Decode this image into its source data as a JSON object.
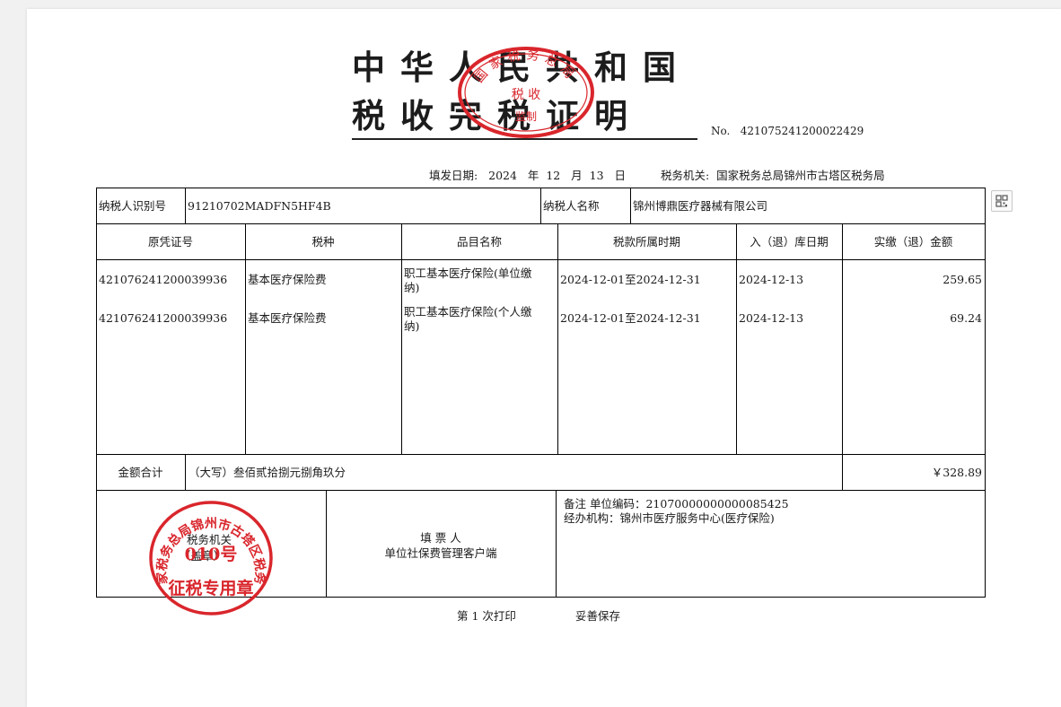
{
  "title": {
    "line1": "中华人民共和国",
    "line2": "税收完税证明"
  },
  "doc_no": {
    "label": "No.",
    "value": "421075241200022429"
  },
  "fill_date": {
    "label": "填发日期:",
    "year": "2024",
    "year_unit": "年",
    "month": "12",
    "month_unit": "月",
    "day": "13",
    "day_unit": "日"
  },
  "tax_authority": {
    "label": "税务机关:",
    "value": "国家税务总局锦州市古塔区税务局"
  },
  "taxpayer": {
    "id_label": "纳税人识别号",
    "id_value": "91210702MADFN5HF4B",
    "name_label": "纳税人名称",
    "name_value": "锦州博鼎医疗器械有限公司"
  },
  "table": {
    "headers": [
      "原凭证号",
      "税种",
      "品目名称",
      "税款所属时期",
      "入（退）库日期",
      "实缴（退）金额"
    ],
    "rows": [
      {
        "voucher": "421076241200039936",
        "tax_type": "基本医疗保险费",
        "item_line1": "职工基本医疗保险(单位缴",
        "item_line2": "纳)",
        "period": "2024-12-01至2024-12-31",
        "date": "2024-12-13",
        "amount": "259.65"
      },
      {
        "voucher": "421076241200039936",
        "tax_type": "基本医疗保险费",
        "item_line1": "职工基本医疗保险(个人缴",
        "item_line2": "纳)",
        "period": "2024-12-01至2024-12-31",
        "date": "2024-12-13",
        "amount": "69.24"
      }
    ]
  },
  "total": {
    "label": "金额合计",
    "words": "（大写）叁佰贰拾捌元捌角玖分",
    "amount": "￥328.89"
  },
  "footer_boxes": {
    "authority_label": "税务机关",
    "authority_suffix": "（盖章）",
    "filler_label": "填 票 人",
    "filler_value": "单位社保费管理客户端",
    "remark_line1": "备注 单位编码：21070000000000085425",
    "remark_line2": "经办机构：锦州市医疗服务中心(医疗保险)"
  },
  "bottom": {
    "print_count": "第 1 次打印",
    "keep_note": "妥善保存"
  },
  "seals": {
    "top_text_arc": "国家税务总局",
    "top_text_center": "税 收",
    "top_text_bottom": "监制",
    "bottom_text_arc": "国家税务总局锦州市古塔区税务局",
    "bottom_number": "010号",
    "bottom_text_center": "征税专用章"
  },
  "colors": {
    "seal_red": "#d9262c",
    "text": "#1a1a1a",
    "border": "#000000"
  },
  "icons": {
    "qr_button": "qr-code-icon"
  }
}
